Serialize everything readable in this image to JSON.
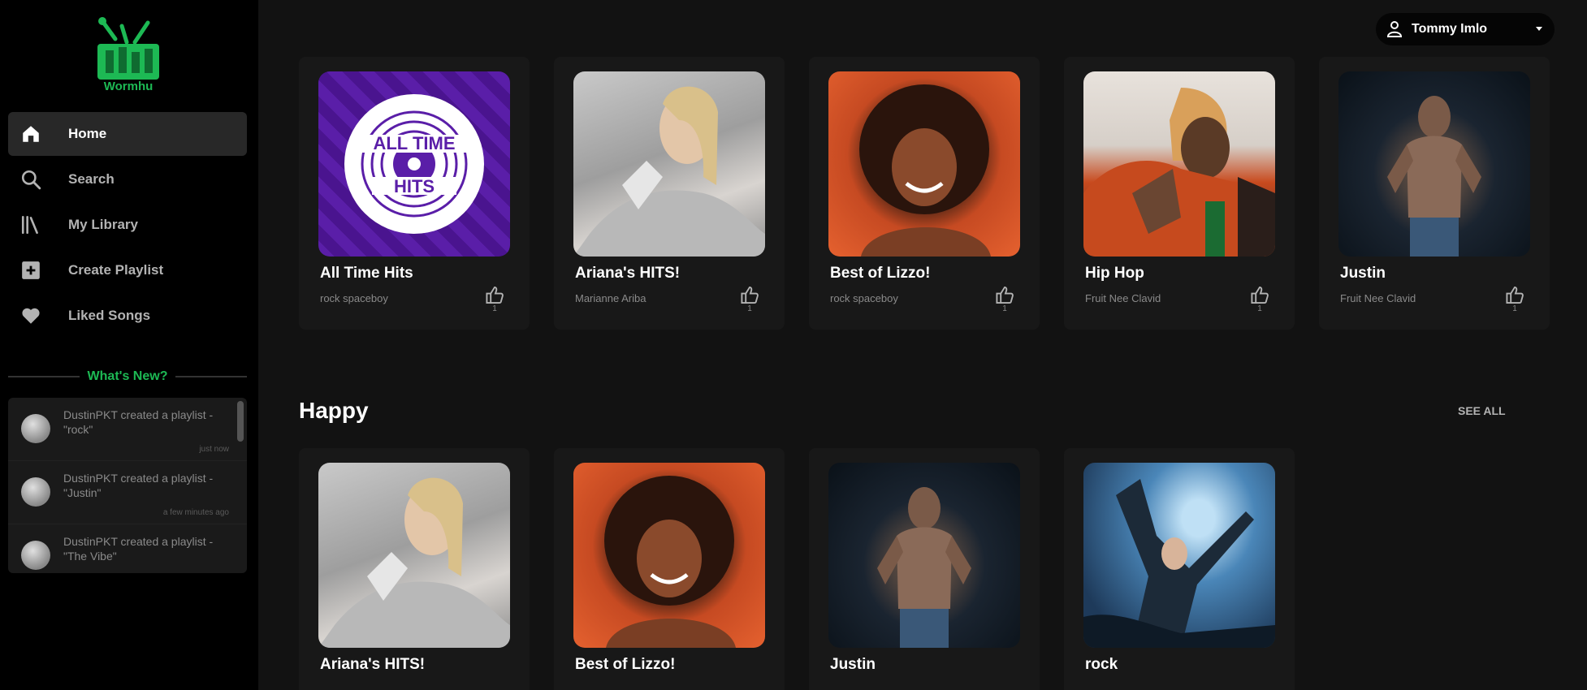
{
  "app": {
    "name": "Wormhu",
    "accent": "#1db954"
  },
  "sidebar": {
    "items": [
      {
        "label": "Home",
        "icon": "home-icon",
        "active": true
      },
      {
        "label": "Search",
        "icon": "search-icon",
        "active": false
      },
      {
        "label": "My Library",
        "icon": "library-icon",
        "active": false
      },
      {
        "label": "Create Playlist",
        "icon": "plus-square-icon",
        "active": false
      },
      {
        "label": "Liked Songs",
        "icon": "heart-icon",
        "active": false
      }
    ],
    "news_title": "What's New?",
    "news": [
      {
        "text": "DustinPKT created a playlist - \"rock\"",
        "time": "just now"
      },
      {
        "text": "DustinPKT created a playlist - \"Justin\"",
        "time": "a few minutes ago"
      },
      {
        "text": "DustinPKT created a playlist - \"The Vibe\"",
        "time": ""
      }
    ]
  },
  "header": {
    "user_name": "Tommy Imlo"
  },
  "row1": [
    {
      "title": "All Time Hits",
      "subtitle": "rock spaceboy",
      "likes": "1",
      "cover": "hits"
    },
    {
      "title": "Ariana's HITS!",
      "subtitle": "Marianne Ariba",
      "likes": "1",
      "cover": "ariana"
    },
    {
      "title": "Best of Lizzo!",
      "subtitle": "rock spaceboy",
      "likes": "1",
      "cover": "lizzo"
    },
    {
      "title": "Hip Hop",
      "subtitle": "Fruit Nee Clavid",
      "likes": "1",
      "cover": "hiphop"
    },
    {
      "title": "Justin",
      "subtitle": "Fruit Nee Clavid",
      "likes": "1",
      "cover": "justin"
    }
  ],
  "section2": {
    "title": "Happy",
    "see_all": "SEE ALL"
  },
  "row2": [
    {
      "title": "Ariana's HITS!",
      "cover": "ariana"
    },
    {
      "title": "Best of Lizzo!",
      "cover": "lizzo"
    },
    {
      "title": "Justin",
      "cover": "justin"
    },
    {
      "title": "rock",
      "cover": "rock"
    }
  ]
}
